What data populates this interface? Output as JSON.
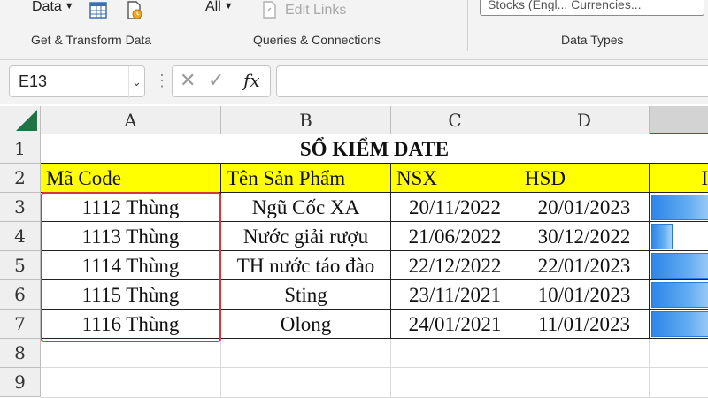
{
  "ribbon": {
    "data_button": "Data",
    "all_button": "All",
    "edit_links": "Edit Links",
    "data_types_combo": "Stocks (Engl... Currencies...",
    "groups": {
      "get_transform": "Get & Transform Data",
      "queries": "Queries & Connections",
      "data_types": "Data Types"
    }
  },
  "formula_bar": {
    "name_box": "E13",
    "fx": "fx",
    "cancel": "✕",
    "enter": "✓",
    "content": ""
  },
  "sheet": {
    "columns": [
      "A",
      "B",
      "C",
      "D"
    ],
    "rows": [
      "1",
      "2",
      "3",
      "4",
      "5",
      "6",
      "7",
      "8",
      "9"
    ],
    "title": "SỔ KIỂM DATE",
    "headers": [
      "Mã Code",
      "Tên Sản Phẩm",
      "NSX",
      "HSD",
      "I"
    ],
    "data": [
      {
        "code": "1112 Thùng",
        "product": "Ngũ Cốc XA",
        "nsx": "20/11/2022",
        "hsd": "20/01/2023",
        "bar_fraction": 0.9
      },
      {
        "code": "1113 Thùng",
        "product": "Nước giải rượu",
        "nsx": "21/06/2022",
        "hsd": "30/12/2022",
        "bar_fraction": 0.3
      },
      {
        "code": "1114 Thùng",
        "product": "TH nước táo đào",
        "nsx": "22/12/2022",
        "hsd": "22/01/2023",
        "bar_fraction": 0.9
      },
      {
        "code": "1115 Thùng",
        "product": "Sting",
        "nsx": "23/11/2021",
        "hsd": "10/01/2023",
        "bar_fraction": 0.9
      },
      {
        "code": "1116 Thùng",
        "product": "Olong",
        "nsx": "24/01/2021",
        "hsd": "11/01/2023",
        "bar_fraction": 0.9
      }
    ]
  },
  "colors": {
    "header_fill": "#ffff00",
    "accent": "#217346",
    "highlight_box": "#d8373a",
    "databar": "#2f86e8"
  }
}
